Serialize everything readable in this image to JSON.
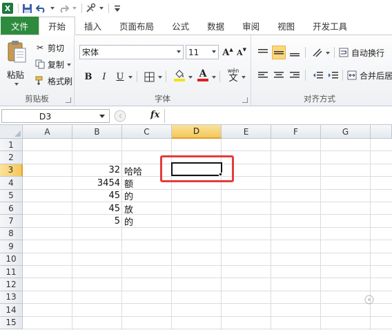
{
  "quick_access": {
    "logo_letter": "X",
    "undo_icon": "undo-icon",
    "redo_icon": "redo-icon",
    "save_icon": "save-icon"
  },
  "tabs": [
    {
      "label": "文件",
      "key": "file"
    },
    {
      "label": "开始",
      "key": "home"
    },
    {
      "label": "插入",
      "key": "insert"
    },
    {
      "label": "页面布局",
      "key": "layout"
    },
    {
      "label": "公式",
      "key": "formulas"
    },
    {
      "label": "数据",
      "key": "data"
    },
    {
      "label": "审阅",
      "key": "review"
    },
    {
      "label": "视图",
      "key": "view"
    },
    {
      "label": "开发工具",
      "key": "developer"
    }
  ],
  "clipboard": {
    "group_label": "剪贴板",
    "paste_label": "粘贴",
    "cut_label": "剪切",
    "copy_label": "复制",
    "painter_label": "格式刷"
  },
  "font": {
    "group_label": "字体",
    "font_name": "宋体",
    "font_size": "11",
    "grow": "A",
    "shrink": "A",
    "bold": "B",
    "italic": "I",
    "underline": "U",
    "phonetic": "wén",
    "phonetic_char": "文",
    "font_color": "#e02020",
    "fill_color": "#f5e020"
  },
  "alignment": {
    "group_label": "对齐方式",
    "wrap_label": "自动换行",
    "merge_label": "合并后居"
  },
  "formula_bar": {
    "cell_ref": "D3",
    "fx": "fx",
    "formula": ""
  },
  "columns": [
    "A",
    "B",
    "C",
    "D",
    "E",
    "F",
    "G"
  ],
  "rows": [
    "1",
    "2",
    "3",
    "4",
    "5",
    "6",
    "7",
    "8",
    "9",
    "10",
    "11",
    "12",
    "13",
    "14",
    "15"
  ],
  "cells": [
    {
      "row": 3,
      "b": "32",
      "c": "哈哈"
    },
    {
      "row": 4,
      "b": "3454",
      "c": "额"
    },
    {
      "row": 5,
      "b": "45",
      "c": "的"
    },
    {
      "row": 6,
      "b": "45",
      "c": "放"
    },
    {
      "row": 7,
      "b": "5",
      "c": "的"
    }
  ],
  "selected_cell": "D3",
  "accent_colors": {
    "file_tab": "#2e8b3e",
    "selection_header": "#f3c85a",
    "highlight": "#e53b3b"
  }
}
